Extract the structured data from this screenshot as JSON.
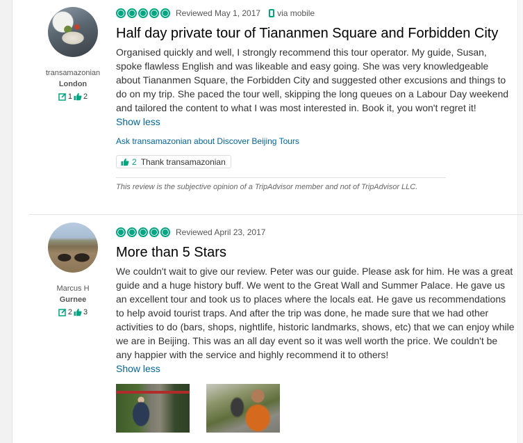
{
  "reviews": [
    {
      "member": {
        "name": "transamazonian",
        "location": "London",
        "contributions": "1",
        "helpful_votes": "2"
      },
      "rating_bubbles": 5,
      "reviewed_date": "Reviewed May 1, 2017",
      "via": "via mobile",
      "title": "Half day private tour of Tiananmen Square and Forbidden City",
      "body": "Organised quickly and well, I strongly recommend this tour operator. My guide, Susan, spoke flawless English and was likeable and easy going. She was very knowledgeable about Tiananmen Square, the Forbidden City and suggested other excusions and things to do on my trip. She paced the tour well, skipping the long queues on a Labour Day weekend and tailored the content to what I was most interested in. Book it, you won't regret it!",
      "show_less": "Show less",
      "ask_link": "Ask transamazonian about Discover Beijing Tours",
      "thank_count": "2",
      "thank_label": "Thank transamazonian",
      "disclaimer": "This review is the subjective opinion of a TripAdvisor member and not of TripAdvisor LLC."
    },
    {
      "member": {
        "name": "Marcus H",
        "location": "Gurnee",
        "contributions": "2",
        "helpful_votes": "3"
      },
      "rating_bubbles": 5,
      "reviewed_date": "Reviewed April 23, 2017",
      "title": "More than 5 Stars",
      "body": "We couldn't wait to give our review. Peter was our guide. Please ask for him. He was a great guide and a huge history buff. We went to the Great Wall and Summer Palace. He gave us an excellent tour and took us to places where the locals eat. He gave us recommendations to help avoid tourist traps. And after the trip was done, he made sure that we had other activities to do (bars, shops, nightlife, historic landmarks, shows, etc) that we can enjoy while we are in Beijing. This was an all day event so it was well worth the price. We couldn't be any happier with the service and highly recommend it to others!",
      "show_less": "Show less"
    }
  ],
  "colors": {
    "accent": "#00a680",
    "link": "#006699"
  },
  "icons": {
    "review_count": "review-pencil-icon",
    "helpful": "thumbs-up-icon",
    "mobile": "phone-icon",
    "bubble": "rating-bubble-icon"
  }
}
